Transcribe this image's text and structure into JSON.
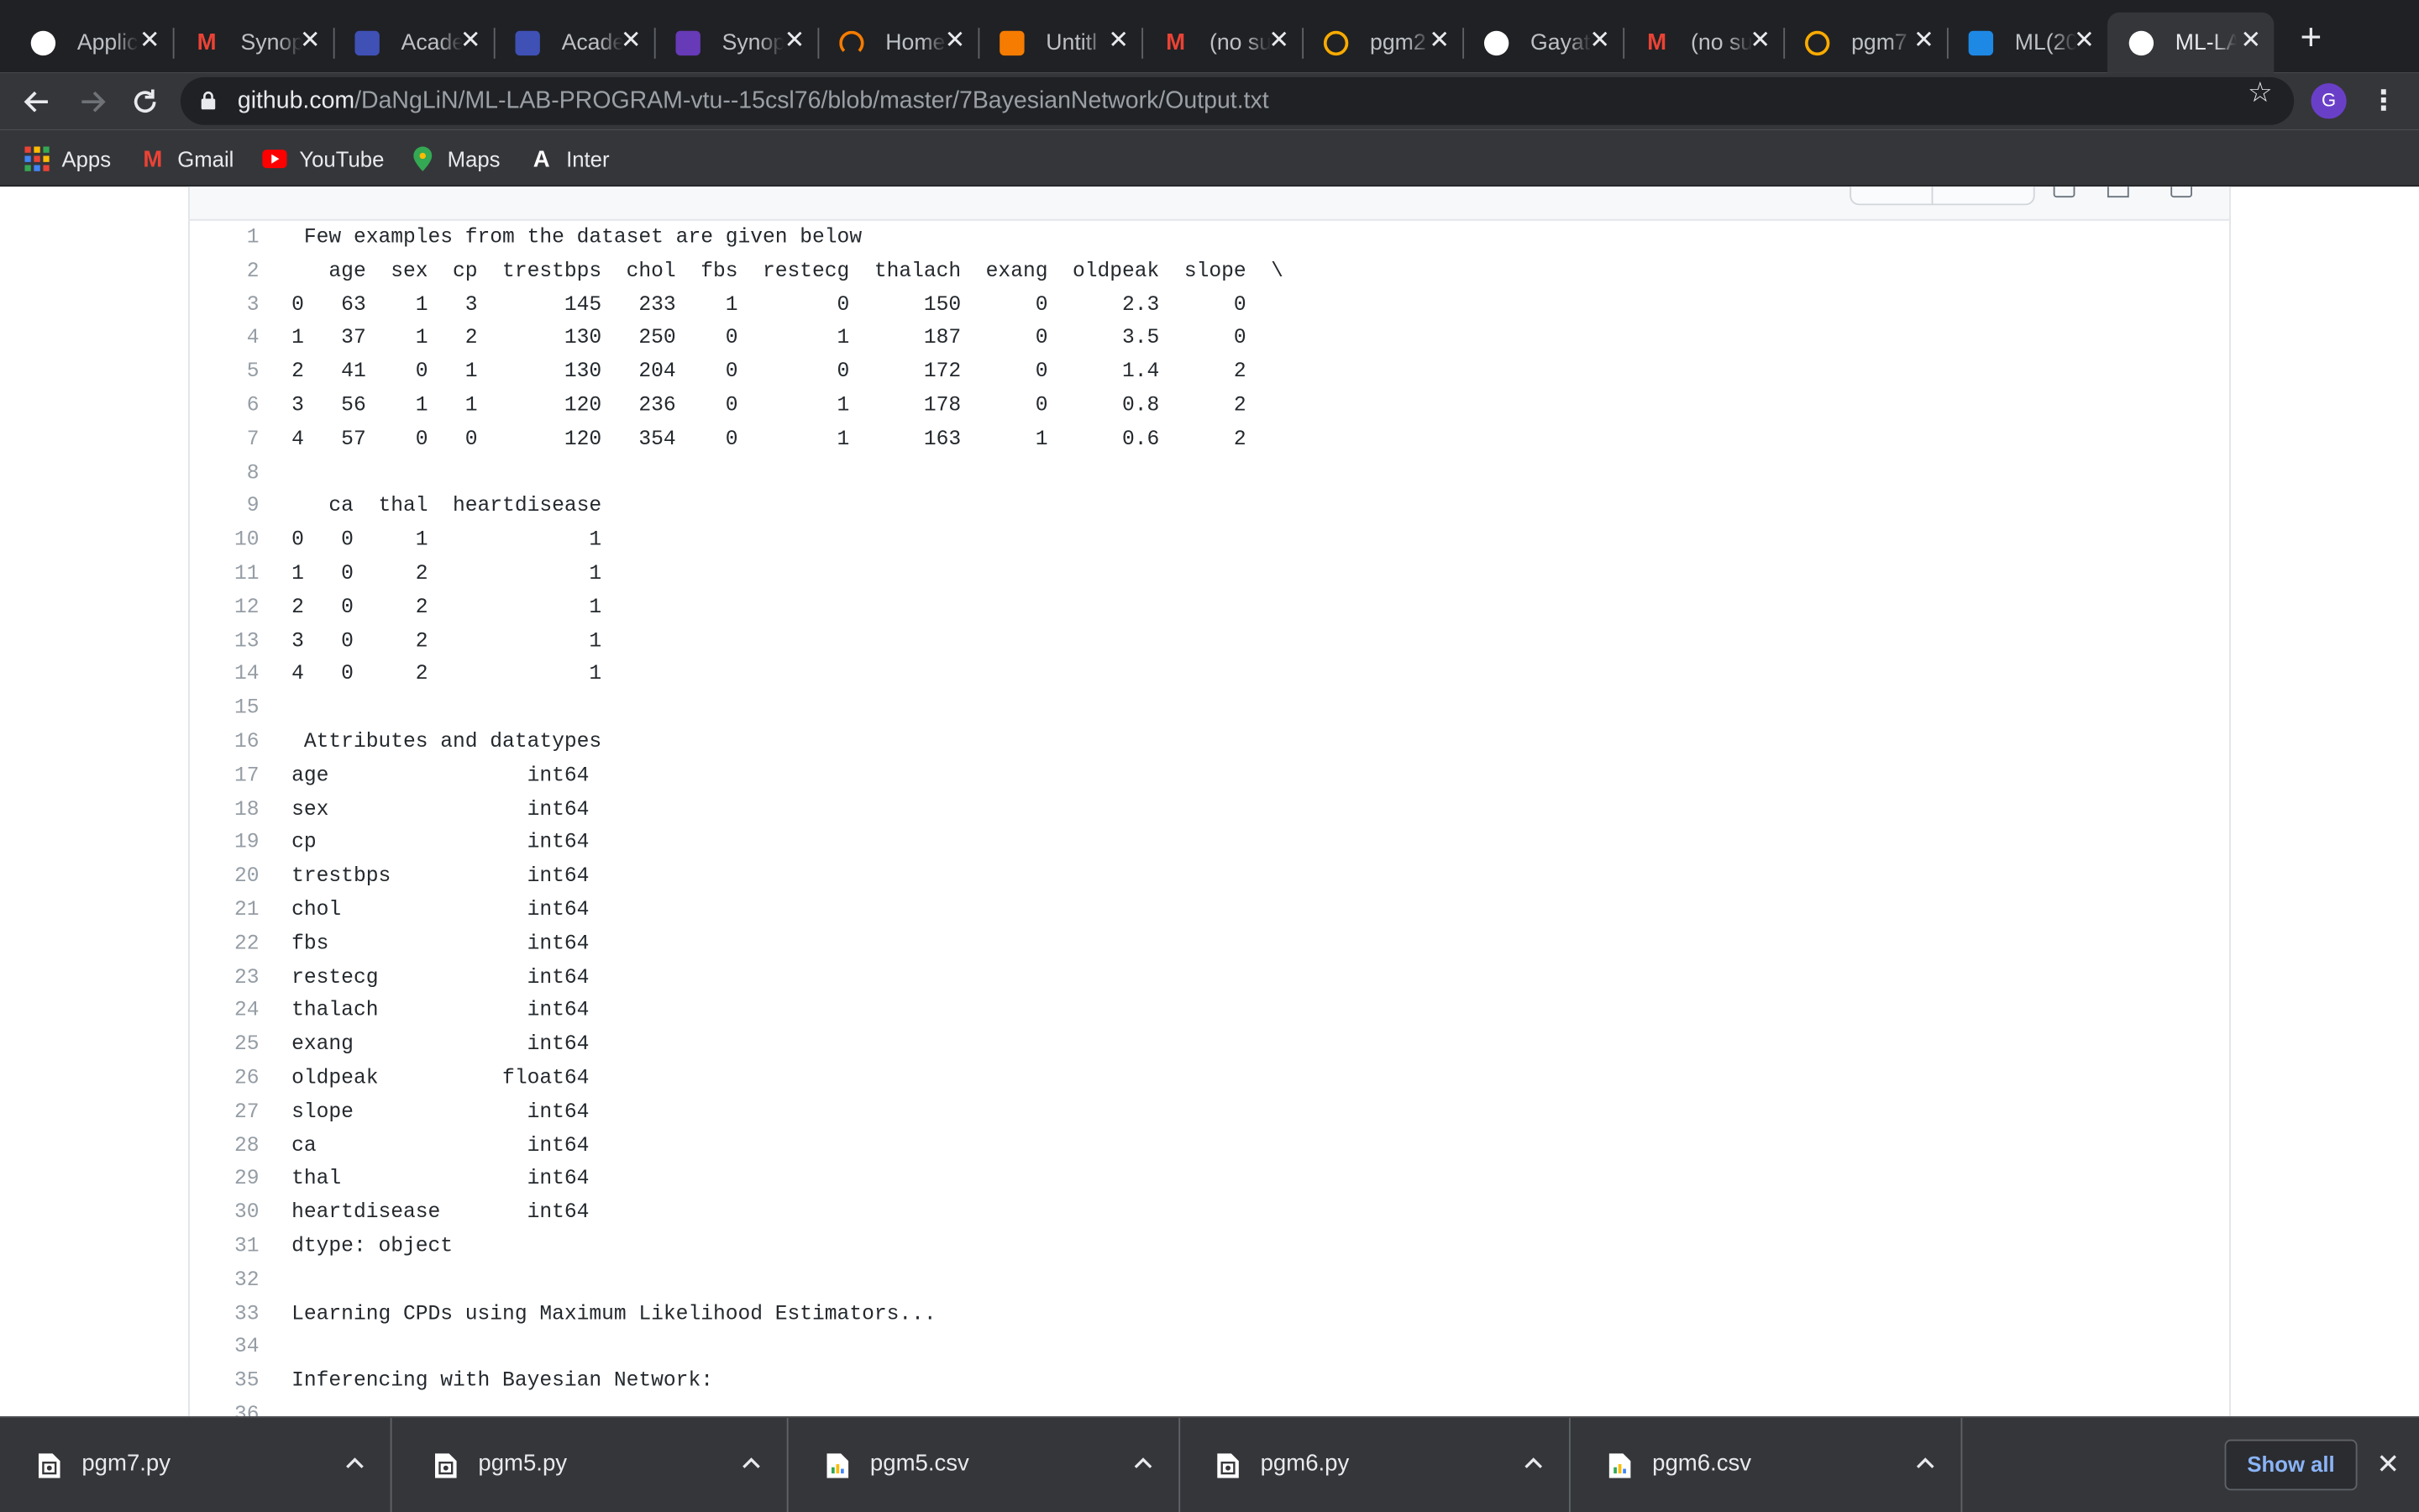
{
  "browser": {
    "tabs": [
      {
        "title": "Applic",
        "icon": "app-icon",
        "color": "#ffffff"
      },
      {
        "title": "Synop",
        "icon": "gmail-icon",
        "color": "#ea4335"
      },
      {
        "title": "Acade",
        "icon": "form-icon",
        "color": "#3f51b5"
      },
      {
        "title": "Acade",
        "icon": "form-icon",
        "color": "#3f51b5"
      },
      {
        "title": "Synop",
        "icon": "list-icon",
        "color": "#673ab7"
      },
      {
        "title": "Home",
        "icon": "loading-icon",
        "color": "#f57c00"
      },
      {
        "title": "Untitl",
        "icon": "notebook-icon",
        "color": "#f57c00"
      },
      {
        "title": "(no su",
        "icon": "gmail-icon",
        "color": "#ea4335"
      },
      {
        "title": "pgm2",
        "icon": "colab-icon",
        "color": "#f9ab00"
      },
      {
        "title": "Gayat",
        "icon": "github-icon",
        "color": "#ffffff"
      },
      {
        "title": "(no su",
        "icon": "gmail-icon",
        "color": "#ea4335"
      },
      {
        "title": "pgm7",
        "icon": "colab-icon",
        "color": "#f9ab00"
      },
      {
        "title": "ML(20",
        "icon": "classroom-icon",
        "color": "#1e88e5"
      },
      {
        "title": "ML-LA",
        "icon": "github-icon",
        "color": "#ffffff",
        "active": true
      }
    ],
    "url_host": "github.com",
    "url_path": "/DaNgLiN/ML-LAB-PROGRAM-vtu--15csl76/blob/master/7BayesianNetwork/Output.txt",
    "avatar_letter": "G",
    "bookmarks": [
      {
        "label": "Apps",
        "icon": "apps-grid-icon"
      },
      {
        "label": "Gmail",
        "icon": "gmail-icon"
      },
      {
        "label": "YouTube",
        "icon": "youtube-icon"
      },
      {
        "label": "Maps",
        "icon": "maps-pin-icon"
      },
      {
        "label": "Inter",
        "icon": "inter-a-icon"
      }
    ]
  },
  "file": {
    "lines": [
      " Few examples from the dataset are given below",
      "   age  sex  cp  trestbps  chol  fbs  restecg  thalach  exang  oldpeak  slope  \\",
      "0   63    1   3       145   233    1        0      150      0      2.3      0",
      "1   37    1   2       130   250    0        1      187      0      3.5      0",
      "2   41    0   1       130   204    0        0      172      0      1.4      2",
      "3   56    1   1       120   236    0        1      178      0      0.8      2",
      "4   57    0   0       120   354    0        1      163      1      0.6      2",
      "",
      "   ca  thal  heartdisease",
      "0   0     1             1",
      "1   0     2             1",
      "2   0     2             1",
      "3   0     2             1",
      "4   0     2             1",
      "",
      " Attributes and datatypes",
      "age                int64",
      "sex                int64",
      "cp                 int64",
      "trestbps           int64",
      "chol               int64",
      "fbs                int64",
      "restecg            int64",
      "thalach            int64",
      "exang              int64",
      "oldpeak          float64",
      "slope              int64",
      "ca                 int64",
      "thal               int64",
      "heartdisease       int64",
      "dtype: object",
      "",
      "Learning CPDs using Maximum Likelihood Estimators...",
      "",
      "Inferencing with Bayesian Network:",
      ""
    ]
  },
  "downloads": {
    "items": [
      {
        "name": "pgm7.py",
        "type": "py"
      },
      {
        "name": "pgm5.py",
        "type": "py"
      },
      {
        "name": "pgm5.csv",
        "type": "csv"
      },
      {
        "name": "pgm6.py",
        "type": "py"
      },
      {
        "name": "pgm6.csv",
        "type": "csv"
      }
    ],
    "show_all": "Show all"
  }
}
